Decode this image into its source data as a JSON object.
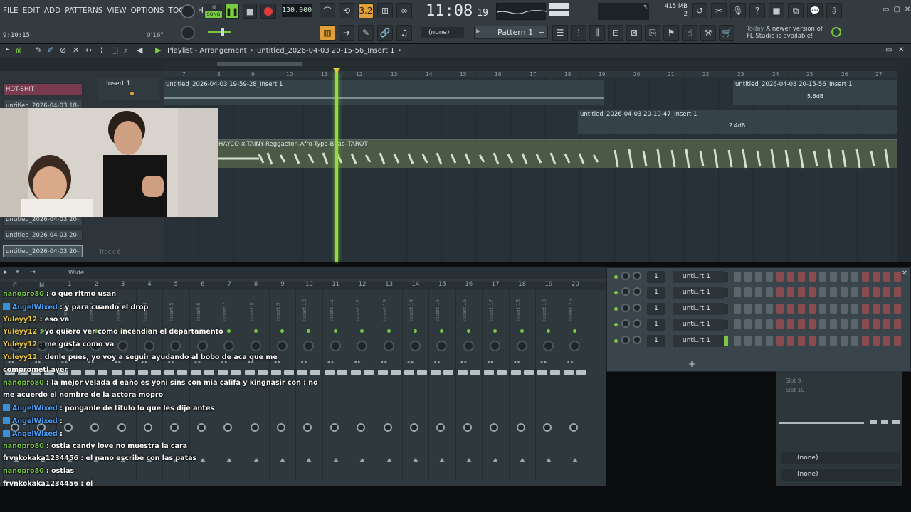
{
  "menu": [
    "FILE",
    "EDIT",
    "ADD",
    "PATTERNS",
    "VIEW",
    "OPTIONS",
    "TOOLS",
    "HELP"
  ],
  "transport": {
    "mode_label": "SONG",
    "tempo": "130.000",
    "clock": "11:08",
    "clock_sub": "19",
    "position": "9:10:15",
    "time_hint": "0'16\"",
    "memory": "415 MB",
    "memory_sub": "2",
    "cpu_num": "3"
  },
  "toolbar": {
    "snap_value": "(none)",
    "pattern_label": "Pattern 1",
    "update_day": "Today",
    "update_text": "A newer version of FL Studio is available!"
  },
  "playlist": {
    "title": "Playlist - Arrangement",
    "breadcrumb": "untitled_2026-04-03 20-15-56_Insert 1",
    "ruler": [
      "7",
      "8",
      "9",
      "10",
      "11",
      "12",
      "13",
      "14",
      "15",
      "16",
      "17",
      "18",
      "19",
      "20",
      "21",
      "22",
      "23",
      "24",
      "25",
      "26",
      "27"
    ],
    "patterns": [
      "HOT-SHIT",
      "untitled_2026-04-03 18-",
      "untitled_2026-04-03 20-",
      "untitled_2026-04-03 20-",
      "untitled_2026-04-03 20-"
    ],
    "track1_label": "Insert 1",
    "track6_label": "Track 6",
    "clips": [
      {
        "label": "untitled_2026-04-03 19-59-28_Insert 1"
      },
      {
        "label": "untitled_2026-04-03 20-15-56_Insert 1",
        "gain": "5.6dB"
      },
      {
        "label": "untitled_2026-04-03 20-10-47_Insert 1",
        "gain": "2.4dB"
      },
      {
        "label": "HAYCO-x-TAINY-Reggaeton-Afro-Type-Beat--TAROT"
      }
    ]
  },
  "mixer": {
    "header_label": "Wide",
    "left_labels": [
      "C",
      "M"
    ],
    "strips": [
      "1",
      "2",
      "3",
      "4",
      "5",
      "6",
      "7",
      "8",
      "9",
      "10",
      "11",
      "12",
      "13",
      "14",
      "15",
      "16",
      "17",
      "18",
      "19",
      "20"
    ],
    "insert_names": [
      "Insert 1",
      "Insert 2",
      "Insert 3",
      "Insert 4",
      "Insert 5",
      "Insert 6",
      "Insert 7",
      "Insert 8",
      "Insert 9",
      "Insert 10",
      "Insert 11",
      "Insert 12",
      "Insert 13",
      "Insert 14",
      "Insert 15",
      "Insert 16",
      "Insert 17",
      "Insert 18",
      "Insert 19",
      "Insert 20"
    ]
  },
  "channel_rack": {
    "rows": [
      {
        "num": "1",
        "name": "unti..rt 1"
      },
      {
        "num": "1",
        "name": "unti..rt 1"
      },
      {
        "num": "1",
        "name": "unti..rt 1"
      },
      {
        "num": "1",
        "name": "unti..rt 1"
      },
      {
        "num": "1",
        "name": "unti..rt 1"
      }
    ]
  },
  "right_panel": {
    "slots": [
      "Slot 9",
      "Slot 10"
    ],
    "send_1": "(none)",
    "send_2": "(none)"
  },
  "chat": [
    {
      "user": "nanopro80",
      "color": "#7ac943",
      "text": "o que ritmo usan",
      "badge": false
    },
    {
      "user": "AngelWixed",
      "color": "#4aa3ff",
      "text": "y para cuando el drop",
      "badge": true
    },
    {
      "user": "Yuleyy12",
      "color": "#e8c440",
      "text": "eso va",
      "badge": false
    },
    {
      "user": "Yuleyy12",
      "color": "#e8c440",
      "text": "yo quiero ver como incendian el departamento",
      "badge": false
    },
    {
      "user": "Yuleyy12",
      "color": "#e8c440",
      "text": "me gusta como va",
      "badge": false
    },
    {
      "user": "Yuleyy12",
      "color": "#e8c440",
      "text": "denle pues, yo voy a seguir ayudando al bobo de aca que me",
      "badge": false
    },
    {
      "user": "",
      "color": "#ffffff",
      "text": "comprometi ayer",
      "badge": false
    },
    {
      "user": "nanopro80",
      "color": "#7ac943",
      "text": "la mejor velada d eaño es yoni sins con mia califa y kingnasir con ; no",
      "badge": false
    },
    {
      "user": "",
      "color": "#ffffff",
      "text": "me acuerdo el nombre de la actora mopro",
      "badge": false
    },
    {
      "user": "AngelWixed",
      "color": "#4aa3ff",
      "text": "ponganle de titulo lo que les dije antes",
      "badge": true
    },
    {
      "user": "AngelWixed",
      "color": "#4aa3ff",
      "text": "",
      "badge": true
    },
    {
      "user": "AngelWixed",
      "color": "#4aa3ff",
      "text": "",
      "badge": true
    },
    {
      "user": "nanopro80",
      "color": "#7ac943",
      "text": "ostia candy love no muestra la cara",
      "badge": false
    },
    {
      "user": "frvnkokaka1234456",
      "color": "#ffffff",
      "text": "el nano escribe con las patas",
      "badge": false
    },
    {
      "user": "nanopro80",
      "color": "#7ac943",
      "text": "ostias",
      "badge": false
    },
    {
      "user": "frvnkokaka1234456",
      "color": "#ffffff",
      "text": "ol",
      "badge": false
    }
  ],
  "colors": {
    "accent_green": "#7ac943",
    "playhead": "#8fdc3a",
    "record": "#e03a3a",
    "rack_step_red": "#8a4a50",
    "rack_step_gray": "#5a666c"
  }
}
